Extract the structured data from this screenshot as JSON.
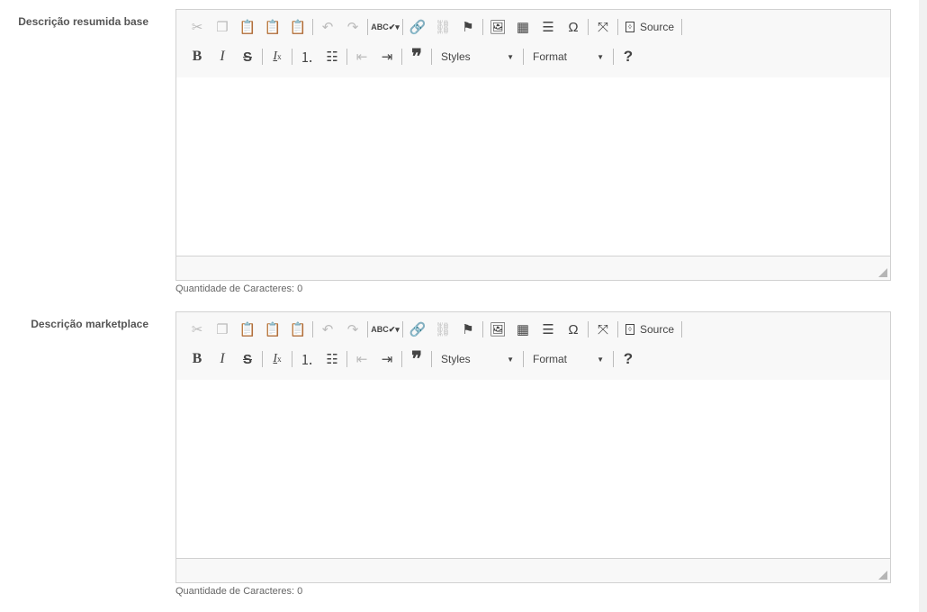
{
  "colors": {
    "toolbar_bg": "#f8f8f8",
    "border": "#d1d1d1",
    "icon": "#444444",
    "disabled_icon": "#bbbbbb"
  },
  "fields": [
    {
      "label": "Descrição resumida base",
      "styles_label": "Styles",
      "format_label": "Format",
      "source_label": "Source",
      "counter": "Quantidade de Caracteres: 0"
    },
    {
      "label": "Descrição marketplace",
      "styles_label": "Styles",
      "format_label": "Format",
      "source_label": "Source",
      "counter": "Quantidade de Caracteres: 0"
    }
  ],
  "toolbar": {
    "bold": "B",
    "italic": "I",
    "strike": "S",
    "remove_format": "Ix",
    "blockquote": "❞",
    "special_char": "Ω",
    "help": "?"
  }
}
